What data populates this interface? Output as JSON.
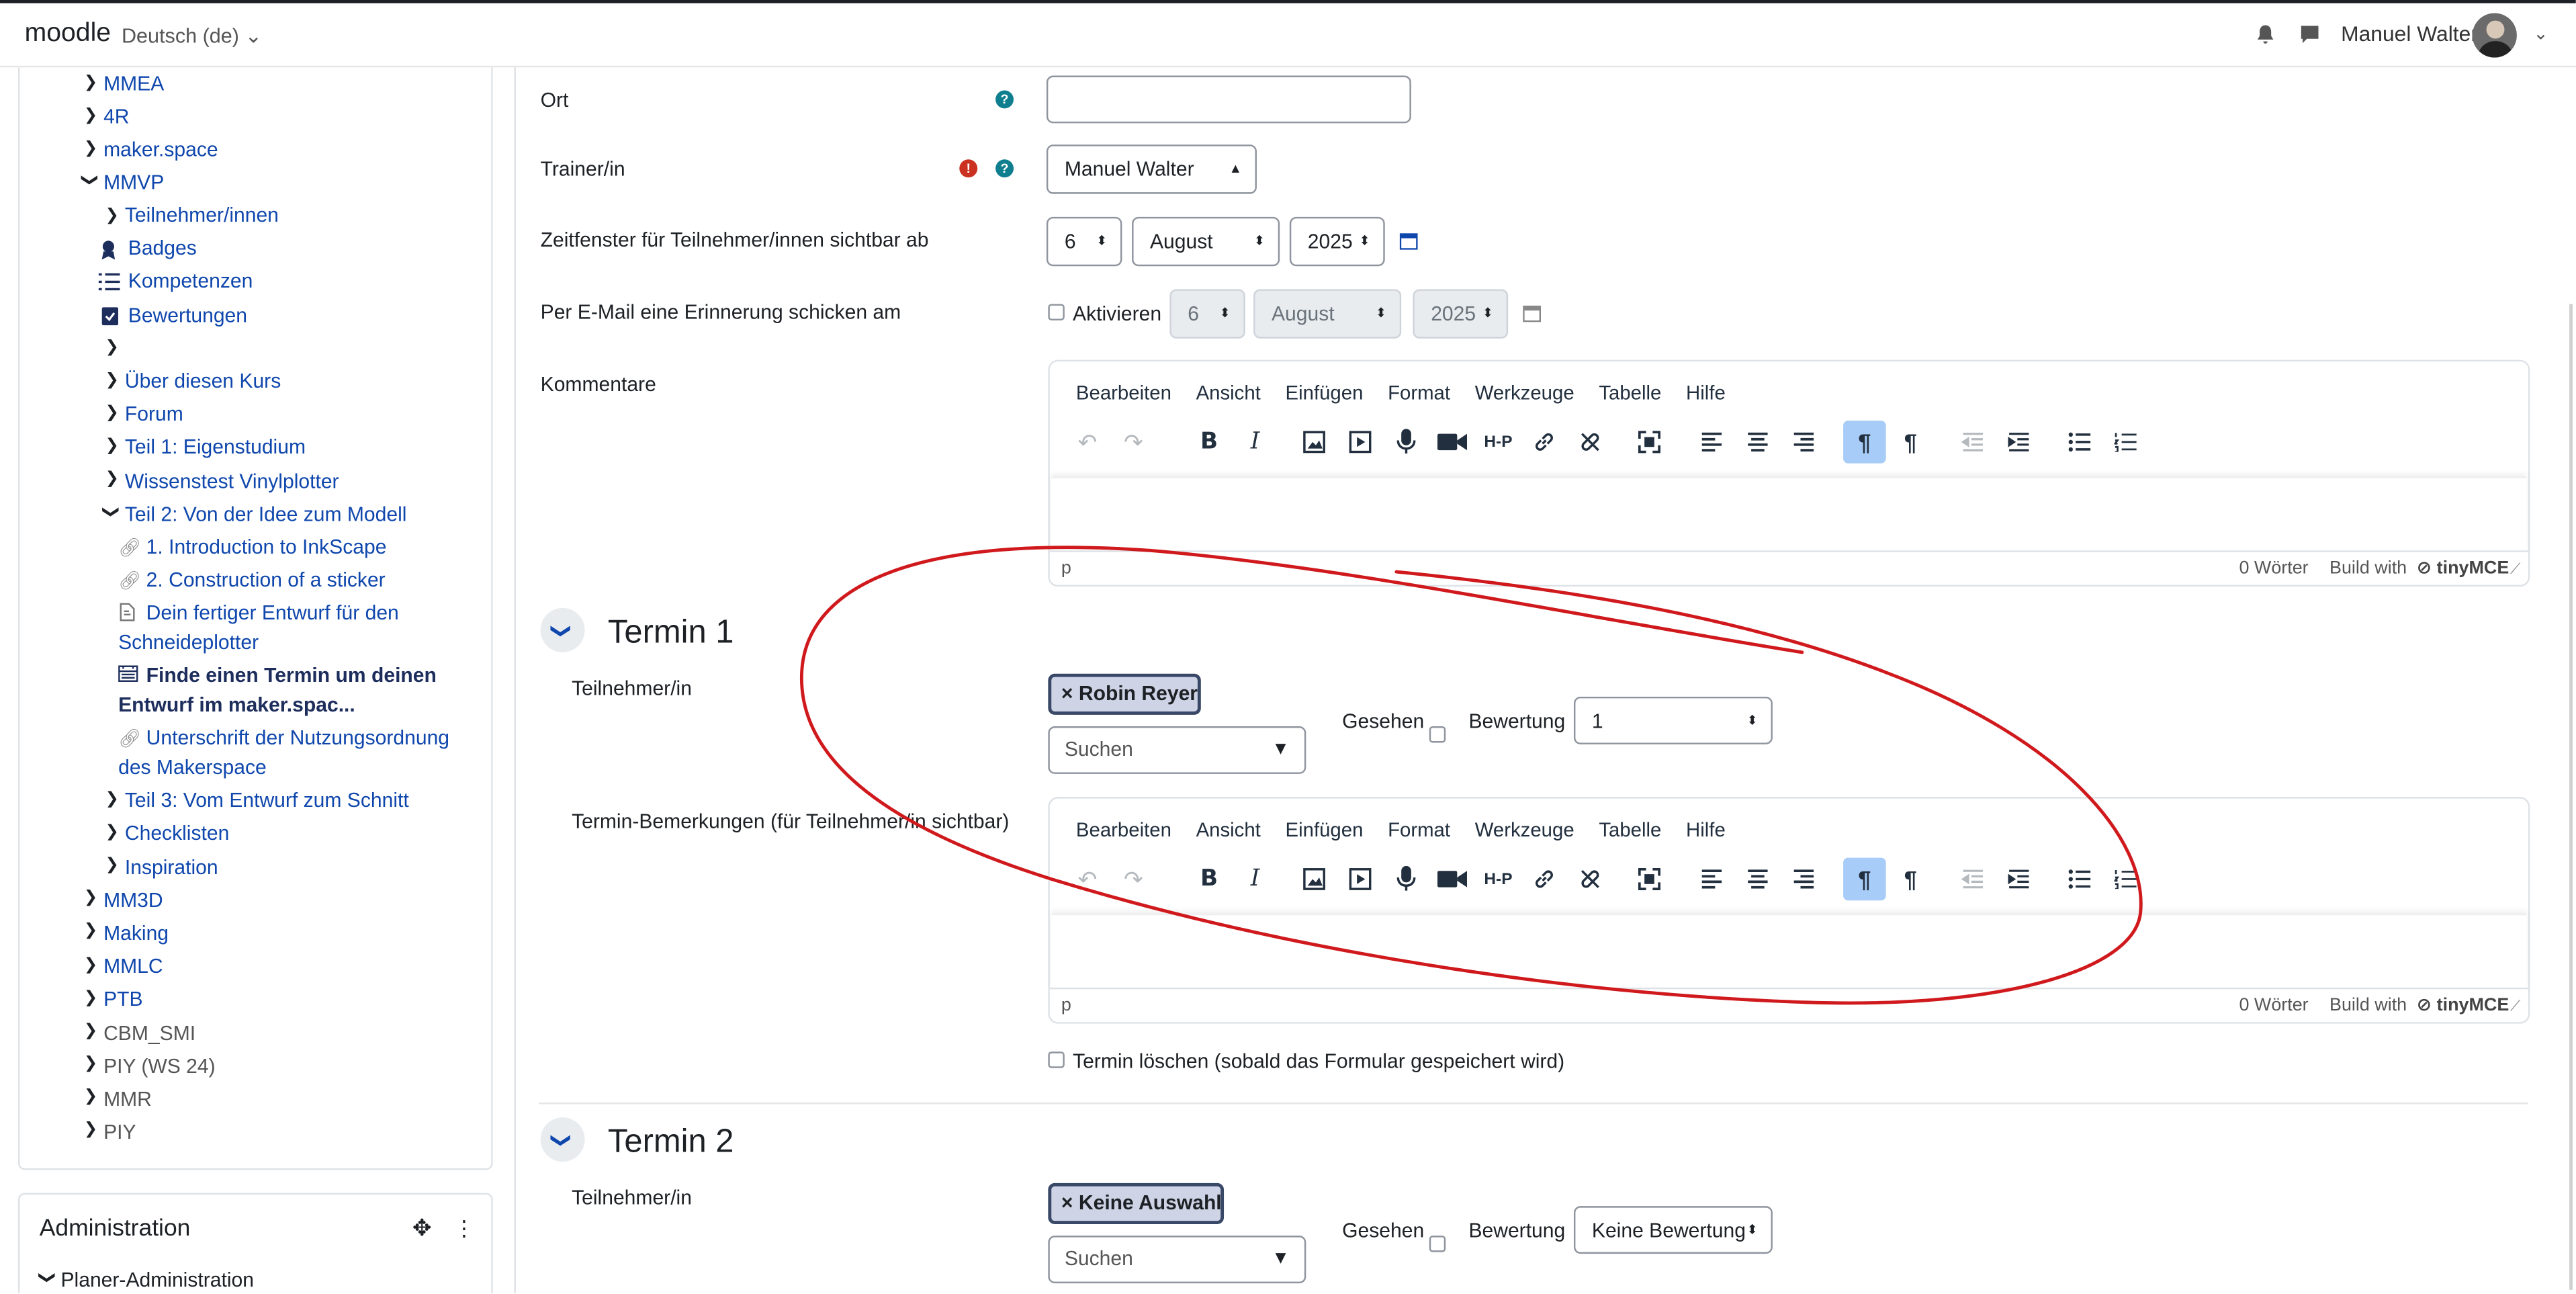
{
  "navbar": {
    "brand": "moodle",
    "language": "Deutsch (de)",
    "user_name": "Manuel Walter"
  },
  "sidebar": {
    "items": [
      {
        "label": "MMEA"
      },
      {
        "label": "4R"
      },
      {
        "label": "maker.space"
      },
      {
        "label": "MMVP"
      },
      {
        "label": "Teilnehmer/innen"
      },
      {
        "label": "Badges"
      },
      {
        "label": "Kompetenzen"
      },
      {
        "label": "Bewertungen"
      },
      {
        "label": "Über diesen Kurs"
      },
      {
        "label": "Forum"
      },
      {
        "label": "Teil 1: Eigenstudium"
      },
      {
        "label": "Wissenstest Vinylplotter"
      },
      {
        "label": "Teil 2: Von der Idee zum Modell"
      },
      {
        "label": "1. Introduction to InkScape"
      },
      {
        "label": "2. Construction of a sticker"
      },
      {
        "label": "Dein fertiger Entwurf für den"
      },
      {
        "label": "Schneideplotter"
      },
      {
        "label": "Finde einen Termin um deinen"
      },
      {
        "label": "Entwurf im maker.spac..."
      },
      {
        "label": "Unterschrift der Nutzungsordnung"
      },
      {
        "label": "des Makerspace"
      },
      {
        "label": "Teil 3: Vom Entwurf zum Schnitt"
      },
      {
        "label": "Checklisten"
      },
      {
        "label": "Inspiration"
      },
      {
        "label": "MM3D"
      },
      {
        "label": "Making"
      },
      {
        "label": "MMLC"
      },
      {
        "label": "PTB"
      },
      {
        "label": "CBM_SMI"
      },
      {
        "label": "PIY (WS 24)"
      },
      {
        "label": "MMR"
      },
      {
        "label": "PIY"
      }
    ],
    "admin_title": "Administration",
    "admin_sub": "Planer-Administration"
  },
  "form": {
    "ort_label": "Ort",
    "trainer_label": "Trainer/in",
    "trainer_value": "Manuel Walter",
    "visible_label": "Zeitfenster für Teilnehmer/innen sichtbar ab",
    "visible_day": "6",
    "visible_month": "August",
    "visible_year": "2025",
    "reminder_label": "Per E-Mail eine Erinnerung schicken am",
    "reminder_activate": "Aktivieren",
    "reminder_day": "6",
    "reminder_month": "August",
    "reminder_year": "2025",
    "comments_label": "Kommentare"
  },
  "editor": {
    "menu": [
      "Bearbeiten",
      "Ansicht",
      "Einfügen",
      "Format",
      "Werkzeuge",
      "Tabelle",
      "Hilfe"
    ],
    "path": "p",
    "words": "0 Wörter",
    "build_with": "Build with",
    "brand": "tinyMCE"
  },
  "slot1": {
    "title": "Termin 1",
    "participant_label": "Teilnehmer/in",
    "participant_tag": "Robin Reyer",
    "search_placeholder": "Suchen",
    "seen_label": "Gesehen",
    "grade_label": "Bewertung",
    "grade_value": "1",
    "remarks_label": "Termin-Bemerkungen (für Teilnehmer/in sichtbar)",
    "delete_label": "Termin löschen (sobald das Formular gespeichert wird)"
  },
  "slot2": {
    "title": "Termin 2",
    "participant_label": "Teilnehmer/in",
    "participant_tag": "Keine Auswahl",
    "search_placeholder": "Suchen",
    "seen_label": "Gesehen",
    "grade_label": "Bewertung",
    "grade_value": "Keine Bewertung"
  },
  "colors": {
    "link": "#0f47ad",
    "annotation": "#d0191c",
    "help": "#0f7f8f",
    "error": "#ca3120",
    "active_button": "#a6ccf7"
  }
}
